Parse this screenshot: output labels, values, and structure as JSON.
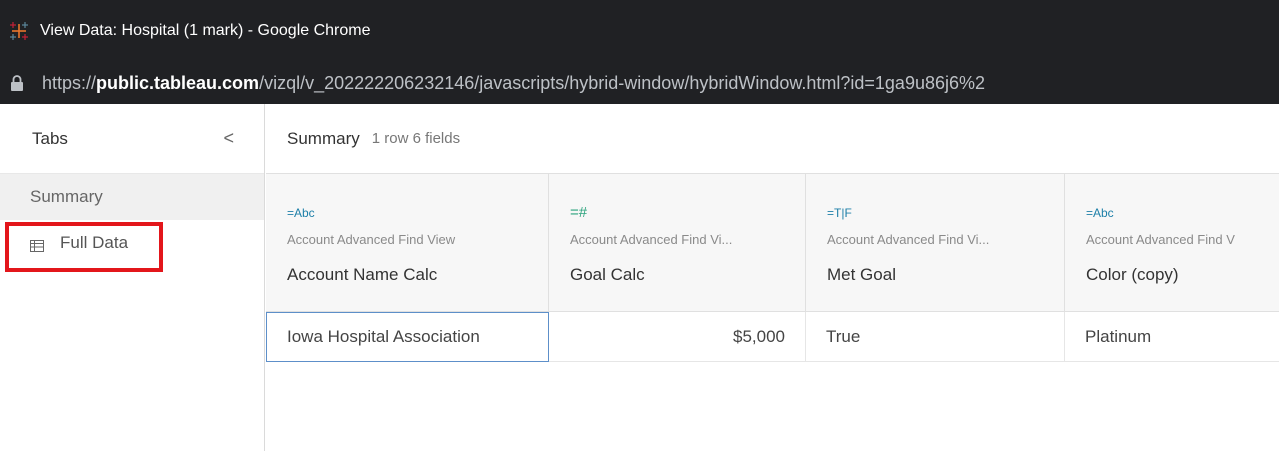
{
  "window": {
    "title": "View Data: Hospital (1 mark) - Google Chrome",
    "url_prefix": "https://",
    "url_host": "public.tableau.com",
    "url_path": "/vizql/v_202222206232146/javascripts/hybrid-window/hybridWindow.html?id=1ga9u86j6%2"
  },
  "sidebar": {
    "title": "Tabs",
    "collapse_glyph": "<",
    "items": [
      {
        "label": "Summary"
      },
      {
        "label": "Full Data"
      }
    ]
  },
  "main": {
    "title": "Summary",
    "meta": "1 row 6 fields"
  },
  "table": {
    "columns": [
      {
        "type_icon": "=Abc",
        "source": "Account Advanced Find View",
        "name": "Account Name Calc"
      },
      {
        "type_icon": "=#",
        "source": "Account Advanced Find Vi...",
        "name": "Goal Calc"
      },
      {
        "type_icon": "=T|F",
        "source": "Account Advanced Find Vi...",
        "name": "Met Goal"
      },
      {
        "type_icon": "=Abc",
        "source": "Account Advanced Find V",
        "name": "Color (copy)"
      }
    ],
    "rows": [
      [
        "Iowa Hospital Association",
        "$5,000",
        "True",
        "Platinum"
      ]
    ]
  },
  "colors": {
    "titlebar": "#202124",
    "highlight": "#e3161b",
    "selection": "#5d8fc9"
  }
}
